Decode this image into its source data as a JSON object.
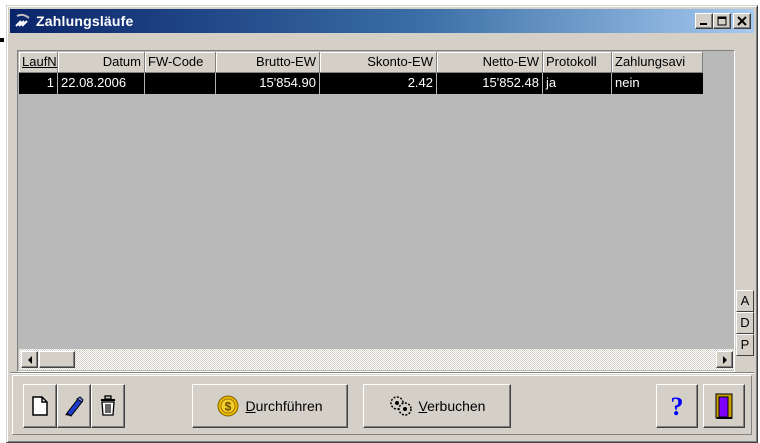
{
  "window": {
    "title": "Zahlungsläufe",
    "app_icon": "app-icon",
    "controls": {
      "minimize": "_",
      "maximize": "□",
      "close": "×"
    }
  },
  "grid": {
    "columns": [
      {
        "label": "LaufNr",
        "align": "left",
        "sorted": true
      },
      {
        "label": "Datum",
        "align": "right"
      },
      {
        "label": "FW-Code",
        "align": "left"
      },
      {
        "label": "Brutto-EW",
        "align": "right"
      },
      {
        "label": "Skonto-EW",
        "align": "right"
      },
      {
        "label": "Netto-EW",
        "align": "right"
      },
      {
        "label": "Protokoll",
        "align": "left"
      },
      {
        "label": "Zahlungsavi",
        "align": "left"
      }
    ],
    "rows": [
      {
        "laufnr": "1",
        "datum": "22.08.2006",
        "fw_code": "",
        "brutto": "15'854.90",
        "skonto": "2.42",
        "netto": "15'852.48",
        "protokoll": "ja",
        "zahlungsavis": "nein"
      }
    ]
  },
  "side_buttons": [
    "A",
    "D",
    "P"
  ],
  "toolbar": {
    "new_icon": "new-document-icon",
    "edit_icon": "edit-pen-icon",
    "delete_icon": "trash-icon",
    "execute_prefix": "",
    "execute_mnemonic": "D",
    "execute_rest": "urchführen",
    "book_mnemonic": "V",
    "book_rest": "erbuchen",
    "help_icon": "help-icon",
    "exit_icon": "exit-door-icon"
  },
  "colors": {
    "title_gradient_start": "#0a246a",
    "title_gradient_end": "#a6caf0",
    "selected_row": "#000000",
    "grid_bg": "#b9b9b9",
    "help_blue": "#0000ff",
    "coin_yellow": "#e8b800"
  }
}
